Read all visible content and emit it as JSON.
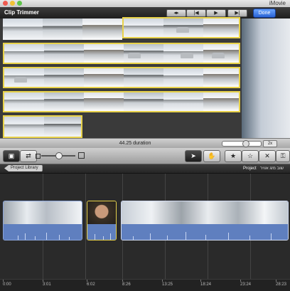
{
  "window": {
    "app_title": "iMovie"
  },
  "clip_trimmer": {
    "title": "Clip Trimmer",
    "done_label": "Done",
    "duration": "44.25 duration",
    "zoom_label": "2x"
  },
  "project": {
    "library_button": "Project Library",
    "breadcrumb_project": "Project",
    "breadcrumb_name": "שוב מזג אוויר"
  },
  "timeline": {
    "ticks": [
      "0:00",
      "3:01",
      "6:02",
      "8:26",
      "13:25",
      "18:24",
      "23:24",
      "28:23"
    ]
  },
  "colors": {
    "selection": "#e8d24a",
    "done_button": "#2a63d4",
    "clip_border": "#8aa4d8"
  }
}
